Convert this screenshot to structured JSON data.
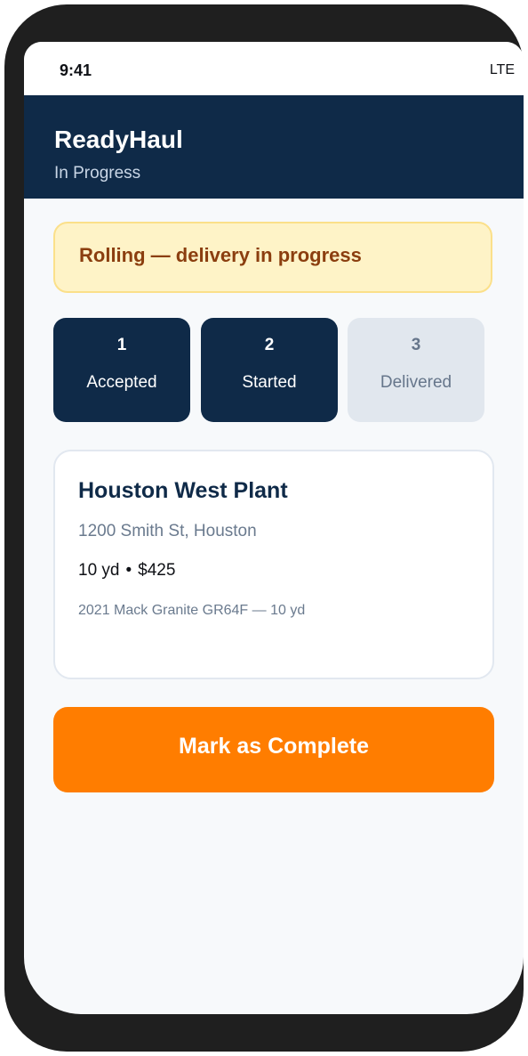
{
  "status_bar": {
    "time": "9:41",
    "network": "LTE"
  },
  "header": {
    "title": "ReadyHaul",
    "subtitle": "In Progress"
  },
  "banner": {
    "text": "Rolling — delivery in progress"
  },
  "steps": [
    {
      "number": "1",
      "label": "Accepted",
      "state": "done"
    },
    {
      "number": "2",
      "label": "Started",
      "state": "done"
    },
    {
      "number": "3",
      "label": "Delivered",
      "state": "pending"
    }
  ],
  "job": {
    "name": "Houston West Plant",
    "address": "1200 Smith St, Houston",
    "quantity": "10 yd",
    "separator": "•",
    "price": "$425",
    "truck": "2021 Mack Granite GR64F — 10 yd"
  },
  "actions": {
    "complete_label": "Mark as Complete"
  },
  "colors": {
    "header_bg": "#0f2a48",
    "banner_bg": "#fef3c7",
    "banner_text": "#8b3e0f",
    "step_done_bg": "#0f2a48",
    "step_pending_bg": "#e1e7ee",
    "primary_action": "#ff7d00"
  }
}
